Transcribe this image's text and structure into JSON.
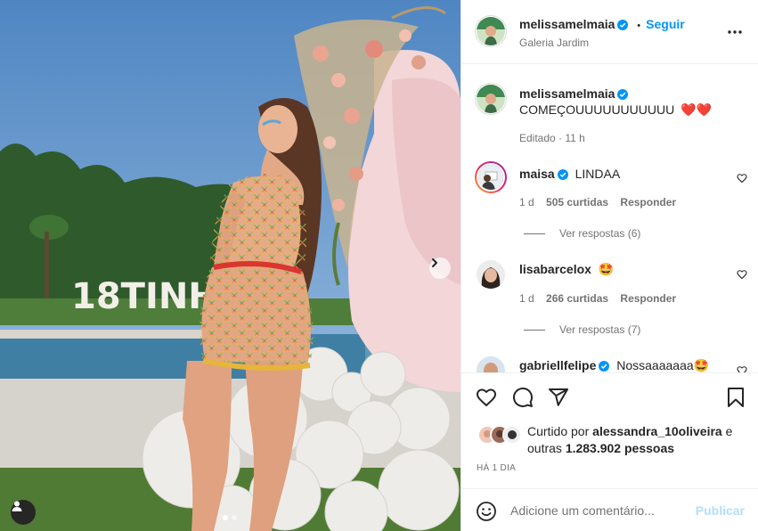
{
  "header": {
    "username": "melissamelmaia",
    "follow_label": "Seguir",
    "separator": "•",
    "location": "Galeria Jardim",
    "more_icon": "more-horizontal-icon"
  },
  "photo": {
    "sign_text": "18TINHO",
    "slide_count": 2,
    "active_slide": 1
  },
  "caption": {
    "username": "melissamelmaia",
    "text": "COMEÇOUUUUUUUUUUU",
    "emoji": "❤️❤️",
    "edited": "Editado",
    "time": "11 h"
  },
  "comments": [
    {
      "username": "maisa",
      "text": "LINDAA",
      "time": "1 d",
      "likes": "505 curtidas",
      "reply": "Responder",
      "view_replies": "Ver respostas (6)"
    },
    {
      "username": "lisabarcelox",
      "text": "🤩",
      "time": "1 d",
      "likes": "266 curtidas",
      "reply": "Responder",
      "view_replies": "Ver respostas (7)"
    },
    {
      "username": "gabriellfelipe",
      "text": "Nossaaaaaaa🤩"
    }
  ],
  "actions": {
    "liked_by_prefix": "Curtido por",
    "liked_by_user": "alessandra_10oliveira",
    "liked_by_and": "e",
    "others_prefix": "outras",
    "others_count": "1.283.902 pessoas",
    "date": "HÁ 1 DIA"
  },
  "add_comment": {
    "placeholder": "Adicione um comentário...",
    "publish_label": "Publicar"
  },
  "colors": {
    "link_blue": "#0095f6",
    "publish_disabled": "#b2dffc",
    "verified": "#0095f6",
    "heart": "#ed4956"
  }
}
